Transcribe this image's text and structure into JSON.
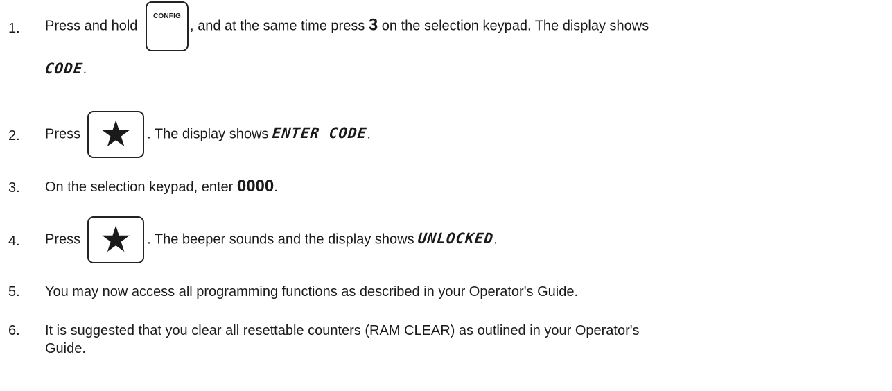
{
  "steps": [
    {
      "number": "1.",
      "before_key": "Press and hold ",
      "key_label": "CONFIG",
      "mid_text": ", and at the same time press ",
      "bold_value": "3",
      "after_bold": " on the selection keypad.  The display shows",
      "display_text": "CODE",
      "end": "."
    },
    {
      "number": "2.",
      "before_key": "Press",
      "key_label": "★",
      "after_key": ".  The display shows ",
      "display_text": "ENTER CODE",
      "end": "."
    },
    {
      "number": "3.",
      "before_bold": "On the selection keypad, enter ",
      "bold_value": "0000",
      "end": "."
    },
    {
      "number": "4.",
      "before_key": "Press",
      "key_label": "★",
      "after_key": ".  The beeper sounds and the display shows ",
      "display_text": "UNLOCKED",
      "end": "."
    },
    {
      "number": "5.",
      "text": "You may now access all programming functions as described in your Operator's Guide."
    },
    {
      "number": "6.",
      "text_line1": "It is suggested that you clear all resettable counters (RAM CLEAR) as outlined in your Operator's",
      "text_line2": "Guide."
    }
  ]
}
